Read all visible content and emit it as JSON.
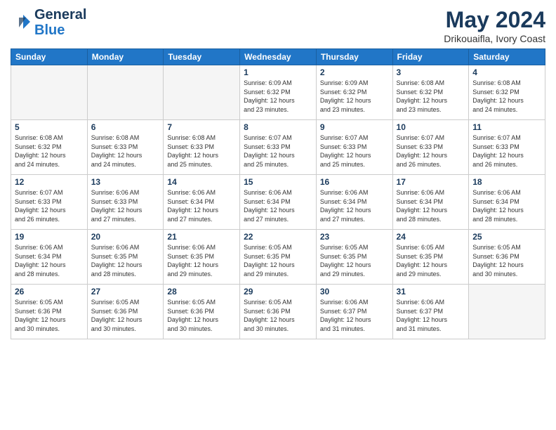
{
  "header": {
    "logo_line1": "General",
    "logo_line2": "Blue",
    "title": "May 2024",
    "subtitle": "Drikouaifla, Ivory Coast"
  },
  "days_of_week": [
    "Sunday",
    "Monday",
    "Tuesday",
    "Wednesday",
    "Thursday",
    "Friday",
    "Saturday"
  ],
  "weeks": [
    [
      {
        "num": "",
        "info": ""
      },
      {
        "num": "",
        "info": ""
      },
      {
        "num": "",
        "info": ""
      },
      {
        "num": "1",
        "info": "Sunrise: 6:09 AM\nSunset: 6:32 PM\nDaylight: 12 hours\nand 23 minutes."
      },
      {
        "num": "2",
        "info": "Sunrise: 6:09 AM\nSunset: 6:32 PM\nDaylight: 12 hours\nand 23 minutes."
      },
      {
        "num": "3",
        "info": "Sunrise: 6:08 AM\nSunset: 6:32 PM\nDaylight: 12 hours\nand 23 minutes."
      },
      {
        "num": "4",
        "info": "Sunrise: 6:08 AM\nSunset: 6:32 PM\nDaylight: 12 hours\nand 24 minutes."
      }
    ],
    [
      {
        "num": "5",
        "info": "Sunrise: 6:08 AM\nSunset: 6:32 PM\nDaylight: 12 hours\nand 24 minutes."
      },
      {
        "num": "6",
        "info": "Sunrise: 6:08 AM\nSunset: 6:33 PM\nDaylight: 12 hours\nand 24 minutes."
      },
      {
        "num": "7",
        "info": "Sunrise: 6:08 AM\nSunset: 6:33 PM\nDaylight: 12 hours\nand 25 minutes."
      },
      {
        "num": "8",
        "info": "Sunrise: 6:07 AM\nSunset: 6:33 PM\nDaylight: 12 hours\nand 25 minutes."
      },
      {
        "num": "9",
        "info": "Sunrise: 6:07 AM\nSunset: 6:33 PM\nDaylight: 12 hours\nand 25 minutes."
      },
      {
        "num": "10",
        "info": "Sunrise: 6:07 AM\nSunset: 6:33 PM\nDaylight: 12 hours\nand 26 minutes."
      },
      {
        "num": "11",
        "info": "Sunrise: 6:07 AM\nSunset: 6:33 PM\nDaylight: 12 hours\nand 26 minutes."
      }
    ],
    [
      {
        "num": "12",
        "info": "Sunrise: 6:07 AM\nSunset: 6:33 PM\nDaylight: 12 hours\nand 26 minutes."
      },
      {
        "num": "13",
        "info": "Sunrise: 6:06 AM\nSunset: 6:33 PM\nDaylight: 12 hours\nand 27 minutes."
      },
      {
        "num": "14",
        "info": "Sunrise: 6:06 AM\nSunset: 6:34 PM\nDaylight: 12 hours\nand 27 minutes."
      },
      {
        "num": "15",
        "info": "Sunrise: 6:06 AM\nSunset: 6:34 PM\nDaylight: 12 hours\nand 27 minutes."
      },
      {
        "num": "16",
        "info": "Sunrise: 6:06 AM\nSunset: 6:34 PM\nDaylight: 12 hours\nand 27 minutes."
      },
      {
        "num": "17",
        "info": "Sunrise: 6:06 AM\nSunset: 6:34 PM\nDaylight: 12 hours\nand 28 minutes."
      },
      {
        "num": "18",
        "info": "Sunrise: 6:06 AM\nSunset: 6:34 PM\nDaylight: 12 hours\nand 28 minutes."
      }
    ],
    [
      {
        "num": "19",
        "info": "Sunrise: 6:06 AM\nSunset: 6:34 PM\nDaylight: 12 hours\nand 28 minutes."
      },
      {
        "num": "20",
        "info": "Sunrise: 6:06 AM\nSunset: 6:35 PM\nDaylight: 12 hours\nand 28 minutes."
      },
      {
        "num": "21",
        "info": "Sunrise: 6:06 AM\nSunset: 6:35 PM\nDaylight: 12 hours\nand 29 minutes."
      },
      {
        "num": "22",
        "info": "Sunrise: 6:05 AM\nSunset: 6:35 PM\nDaylight: 12 hours\nand 29 minutes."
      },
      {
        "num": "23",
        "info": "Sunrise: 6:05 AM\nSunset: 6:35 PM\nDaylight: 12 hours\nand 29 minutes."
      },
      {
        "num": "24",
        "info": "Sunrise: 6:05 AM\nSunset: 6:35 PM\nDaylight: 12 hours\nand 29 minutes."
      },
      {
        "num": "25",
        "info": "Sunrise: 6:05 AM\nSunset: 6:36 PM\nDaylight: 12 hours\nand 30 minutes."
      }
    ],
    [
      {
        "num": "26",
        "info": "Sunrise: 6:05 AM\nSunset: 6:36 PM\nDaylight: 12 hours\nand 30 minutes."
      },
      {
        "num": "27",
        "info": "Sunrise: 6:05 AM\nSunset: 6:36 PM\nDaylight: 12 hours\nand 30 minutes."
      },
      {
        "num": "28",
        "info": "Sunrise: 6:05 AM\nSunset: 6:36 PM\nDaylight: 12 hours\nand 30 minutes."
      },
      {
        "num": "29",
        "info": "Sunrise: 6:05 AM\nSunset: 6:36 PM\nDaylight: 12 hours\nand 30 minutes."
      },
      {
        "num": "30",
        "info": "Sunrise: 6:06 AM\nSunset: 6:37 PM\nDaylight: 12 hours\nand 31 minutes."
      },
      {
        "num": "31",
        "info": "Sunrise: 6:06 AM\nSunset: 6:37 PM\nDaylight: 12 hours\nand 31 minutes."
      },
      {
        "num": "",
        "info": ""
      }
    ]
  ]
}
